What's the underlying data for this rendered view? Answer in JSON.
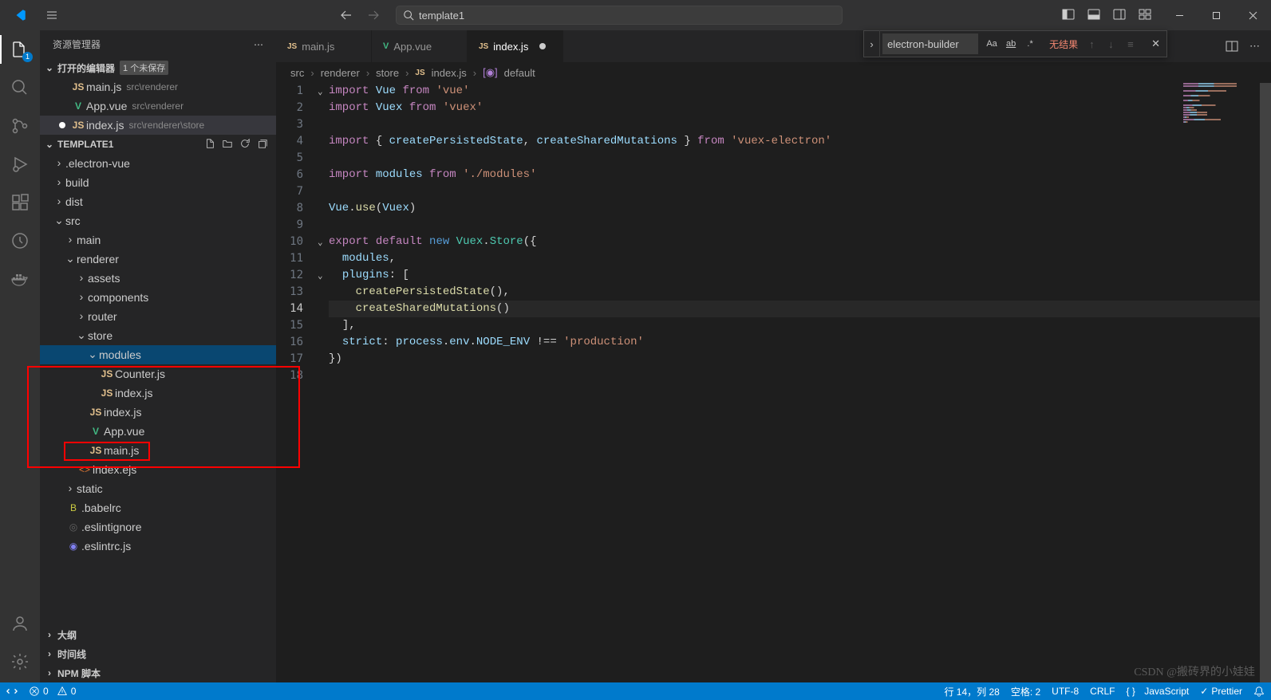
{
  "titlebar": {
    "search_text": "template1"
  },
  "sidebar": {
    "title": "资源管理器",
    "open_editors_label": "打开的编辑器",
    "open_editors_badge": "1 个未保存",
    "project_name": "TEMPLATE1",
    "outline": "大纲",
    "timeline": "时间线",
    "npm": "NPM 脚本"
  },
  "open_editors": [
    {
      "name": "main.js",
      "path": "src\\renderer",
      "type": "js",
      "modified": false
    },
    {
      "name": "App.vue",
      "path": "src\\renderer",
      "type": "vue",
      "modified": false
    },
    {
      "name": "index.js",
      "path": "src\\renderer\\store",
      "type": "js",
      "modified": true
    }
  ],
  "tree": {
    "electron_vue": ".electron-vue",
    "build": "build",
    "dist": "dist",
    "src": "src",
    "main_folder": "main",
    "renderer": "renderer",
    "assets": "assets",
    "components": "components",
    "router": "router",
    "store": "store",
    "modules": "modules",
    "counter": "Counter.js",
    "modules_index": "index.js",
    "store_index": "index.js",
    "app_vue": "App.vue",
    "main_js": "main.js",
    "index_ejs": "index.ejs",
    "static": "static",
    "babelrc": ".babelrc",
    "eslintignore": ".eslintignore",
    "eslintrc": ".eslintrc.js"
  },
  "tabs": [
    {
      "name": "main.js",
      "type": "js",
      "active": false
    },
    {
      "name": "App.vue",
      "type": "vue",
      "active": false
    },
    {
      "name": "index.js",
      "type": "js",
      "active": true,
      "modified": true
    }
  ],
  "breadcrumb": {
    "p1": "src",
    "p2": "renderer",
    "p3": "store",
    "p4": "index.js",
    "p5": "default"
  },
  "find": {
    "value": "electron-builder",
    "result": "无结果"
  },
  "code_lines": [
    {
      "n": 1,
      "fold": "v",
      "html": "<span class='tk-kw'>import</span> <span class='tk-var'>Vue</span> <span class='tk-kw'>from</span> <span class='tk-str'>'vue'</span>"
    },
    {
      "n": 2,
      "html": "<span class='tk-kw'>import</span> <span class='tk-var'>Vuex</span> <span class='tk-kw'>from</span> <span class='tk-str'>'vuex'</span>"
    },
    {
      "n": 3,
      "html": ""
    },
    {
      "n": 4,
      "html": "<span class='tk-kw'>import</span> <span class='tk-pun'>{</span> <span class='tk-var'>createPersistedState</span><span class='tk-pun'>,</span> <span class='tk-var'>createSharedMutations</span> <span class='tk-pun'>}</span> <span class='tk-kw'>from</span> <span class='tk-str'>'vuex-electron'</span>"
    },
    {
      "n": 5,
      "html": ""
    },
    {
      "n": 6,
      "html": "<span class='tk-kw'>import</span> <span class='tk-var'>modules</span> <span class='tk-kw'>from</span> <span class='tk-str'>'./modules'</span>"
    },
    {
      "n": 7,
      "html": ""
    },
    {
      "n": 8,
      "html": "<span class='tk-var'>Vue</span><span class='tk-pun'>.</span><span class='tk-fn'>use</span><span class='tk-pun'>(</span><span class='tk-var'>Vuex</span><span class='tk-pun'>)</span>"
    },
    {
      "n": 9,
      "html": ""
    },
    {
      "n": 10,
      "fold": "v",
      "html": "<span class='tk-kw'>export</span> <span class='tk-kw'>default</span> <span class='tk-const'>new</span> <span class='tk-cls'>Vuex</span><span class='tk-pun'>.</span><span class='tk-cls'>Store</span><span class='tk-pun'>({</span>"
    },
    {
      "n": 11,
      "html": "  <span class='tk-var'>modules</span><span class='tk-pun'>,</span>"
    },
    {
      "n": 12,
      "fold": "v",
      "html": "  <span class='tk-prop'>plugins</span><span class='tk-pun'>:</span> <span class='tk-pun'>[</span>"
    },
    {
      "n": 13,
      "html": "    <span class='tk-fn'>createPersistedState</span><span class='tk-pun'>(),</span>"
    },
    {
      "n": 14,
      "cur": true,
      "hl": true,
      "html": "    <span class='tk-fn'>createSharedMutations</span><span class='tk-pun'>()</span>"
    },
    {
      "n": 15,
      "html": "  <span class='tk-pun'>],</span>"
    },
    {
      "n": 16,
      "html": "  <span class='tk-prop'>strict</span><span class='tk-pun'>:</span> <span class='tk-var'>process</span><span class='tk-pun'>.</span><span class='tk-var'>env</span><span class='tk-pun'>.</span><span class='tk-prop'>NODE_ENV</span> <span class='tk-pun'>!==</span> <span class='tk-str'>'production'</span>"
    },
    {
      "n": 17,
      "html": "<span class='tk-pun'>})</span>"
    },
    {
      "n": 18,
      "html": ""
    }
  ],
  "statusbar": {
    "errors": "0",
    "warnings": "0",
    "line_col": "行 14，列 28",
    "spaces": "空格: 2",
    "encoding": "UTF-8",
    "eol": "CRLF",
    "lang": "JavaScript",
    "prettier": "Prettier"
  },
  "watermark": "CSDN @搬砖界的小娃娃"
}
